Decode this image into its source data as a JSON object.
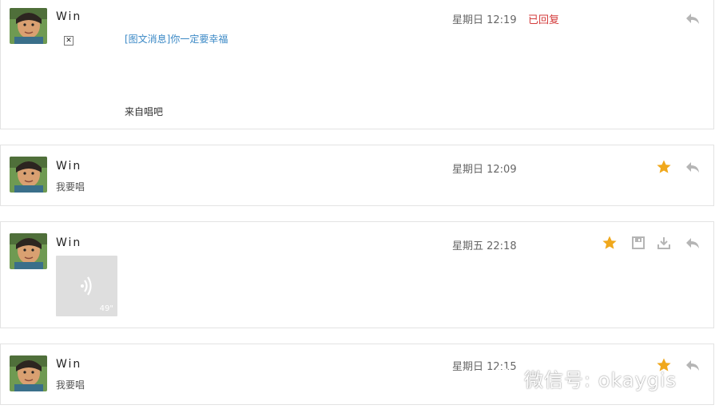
{
  "messages": [
    {
      "sender": "Win",
      "time": "星期日 12:19",
      "status": "已回复",
      "link_text": "[图文消息]你一定要幸福",
      "from_text": "来自唱吧",
      "broken_image_glyph": "✕"
    },
    {
      "sender": "Win",
      "time": "星期日 12:09",
      "text": "我要唱"
    },
    {
      "sender": "Win",
      "time": "星期五 22:18",
      "voice_duration": "49\""
    },
    {
      "sender": "Win",
      "time": "星期日 12:15",
      "text": "我要唱"
    }
  ],
  "icons": {
    "star": "star-icon",
    "save": "save-icon",
    "download": "download-icon",
    "reply": "reply-icon"
  },
  "colors": {
    "star": "#f0a81c",
    "icon_gray": "#b5b5b5",
    "link": "#3b89c6",
    "status": "#d33b3b"
  },
  "watermark": {
    "text": "微信号: okaygis"
  }
}
